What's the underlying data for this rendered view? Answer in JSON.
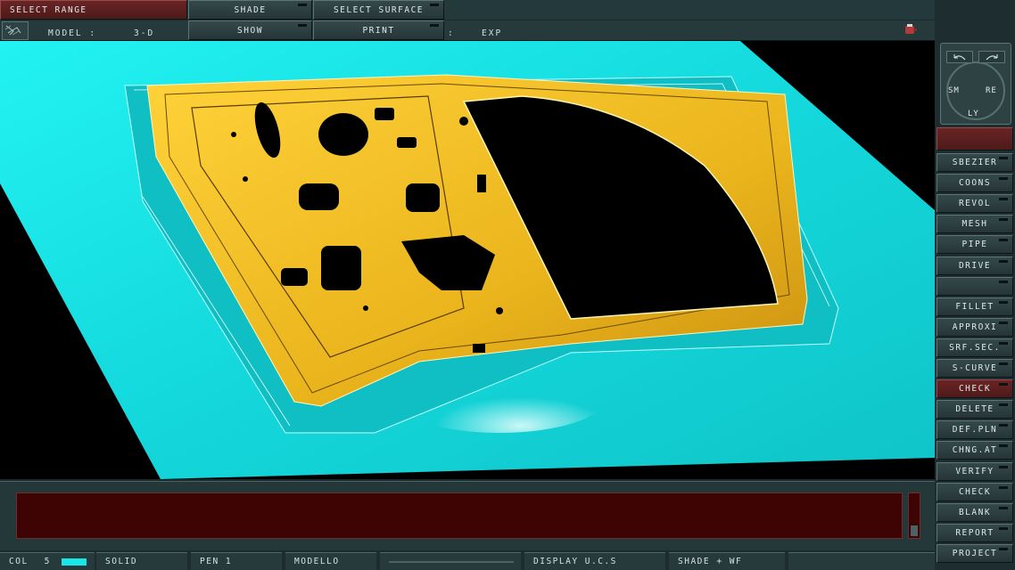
{
  "top_menu": {
    "select_range": "SELECT RANGE",
    "shade": "SHADE",
    "select_surface": "SELECT SURFACE",
    "show": "SHOW",
    "print": "PRINT"
  },
  "info_bar": {
    "model_label": "MODEL  :",
    "model_value": "3-D",
    "colon": ":",
    "mode_value": "EXP"
  },
  "view_widget": {
    "sm": "SM",
    "re": "RE",
    "ly": "LY"
  },
  "side_menu": [
    "SBEZIER",
    "COONS",
    "REVOL",
    "MESH",
    "PIPE",
    "DRIVE",
    "",
    "FILLET",
    "APPROXI",
    "SRF.SEC.",
    "S-CURVE",
    "CHECK",
    "DELETE",
    "DEF.PLN",
    "CHNG.AT",
    "VERIFY",
    "CHECK",
    "BLANK",
    "REPORT",
    "PROJECT"
  ],
  "status_bar": {
    "col_label": "COL",
    "col_value": "5",
    "mode": "SOLID",
    "pen": "PEN 1",
    "layer": "MODELLO",
    "display": "DISPLAY U.C.S",
    "render": "SHADE + WF"
  },
  "colors": {
    "cyan_surface": "#19e6e6",
    "yellow_part": "#f0c020",
    "highlight_red": "#6a2424"
  }
}
